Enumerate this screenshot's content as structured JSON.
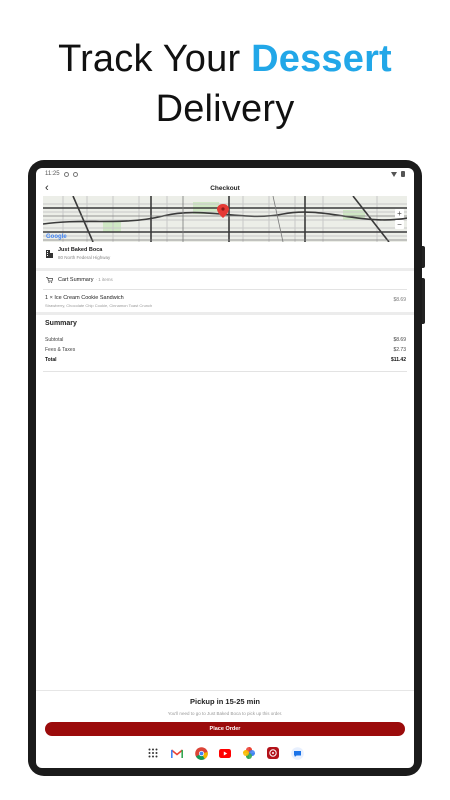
{
  "hero": {
    "line1_prefix": "Track Your",
    "line1_accent": "Dessert",
    "line2": "Delivery",
    "accent_color": "#22a7e8"
  },
  "status_bar": {
    "time": "11:25"
  },
  "app_bar": {
    "title": "Checkout",
    "back_icon": "back-arrow-icon"
  },
  "map": {
    "provider_label": "Google",
    "zoom_in": "+",
    "zoom_out": "−"
  },
  "store": {
    "name": "Just Baked Boca",
    "address": "80 North Federal Highway"
  },
  "cart": {
    "label": "Cart Summary",
    "count": "· 1 items",
    "items": [
      {
        "name": "1 × Ice Cream Cookie Sandwich",
        "options": "Strawberry, Chocolate Chip Cookie, Cinnamon Toast Crunch",
        "price": "$8.69"
      }
    ]
  },
  "summary": {
    "title": "Summary",
    "rows": [
      {
        "label": "Subtotal",
        "value": "$8.69"
      },
      {
        "label": "Fees & Taxes",
        "value": "$2.73"
      },
      {
        "label": "Total",
        "value": "$11.42"
      }
    ]
  },
  "pickup": {
    "title": "Pickup in 15-25 min",
    "note": "You'll need to go to Just Baked Boca to pick up this order."
  },
  "place_order": {
    "label": "Place Order",
    "color": "#9b0b0b"
  },
  "dock_icons": [
    "apps-icon",
    "gmail-icon",
    "chrome-icon",
    "youtube-icon",
    "photos-icon",
    "just-baked-icon",
    "messages-icon"
  ]
}
